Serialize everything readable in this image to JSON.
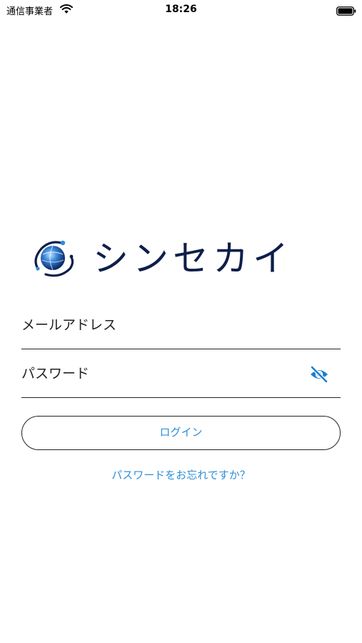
{
  "status_bar": {
    "carrier": "通信事業者",
    "time": "18:26",
    "wifi_icon": "wifi-icon",
    "battery_icon": "battery-icon"
  },
  "logo": {
    "text": "シンセカイ",
    "mark_icon": "globe-orbit-logo"
  },
  "form": {
    "email_placeholder": "メールアドレス",
    "email_value": "",
    "password_placeholder": "パスワード",
    "password_value": "",
    "visibility_icon": "eye-slash-icon",
    "login_label": "ログイン",
    "forgot_label": "パスワードをお忘れですか？"
  },
  "colors": {
    "accent": "#2e8fd8",
    "logo_text": "#0d1e4a",
    "border": "#222222",
    "background": "#ffffff"
  }
}
